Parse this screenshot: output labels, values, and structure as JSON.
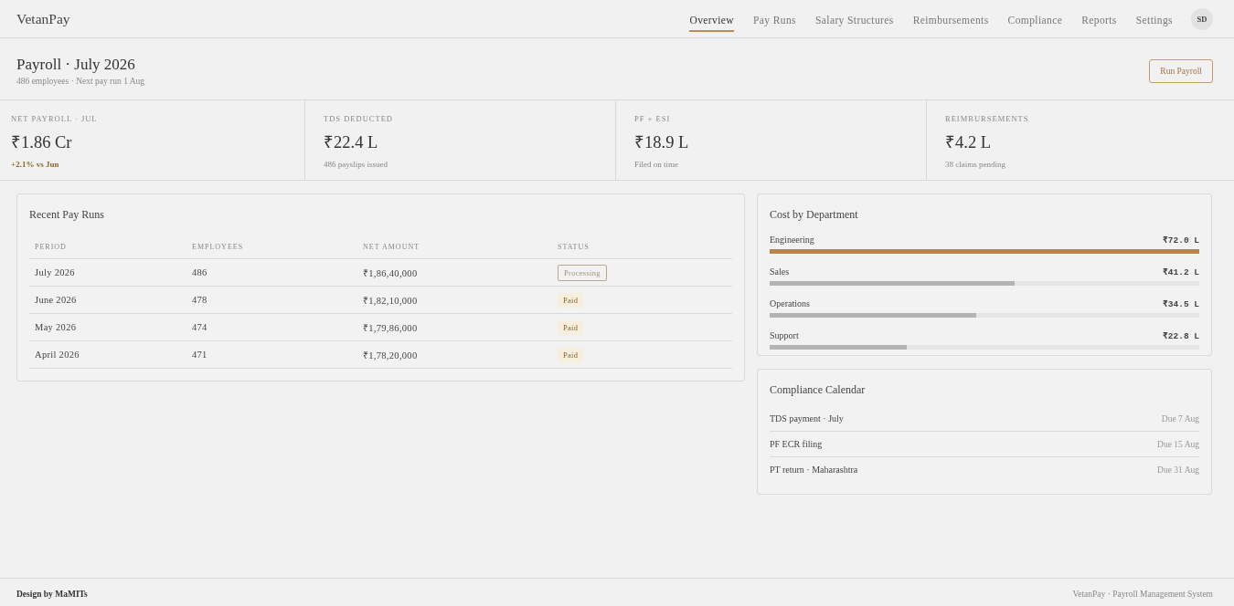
{
  "app": {
    "logo": "VetanPay"
  },
  "nav": [
    {
      "label": "Overview",
      "selected": true
    },
    {
      "label": "Pay Runs",
      "selected": false
    },
    {
      "label": "Salary Structures",
      "selected": false
    },
    {
      "label": "Reimbursements",
      "selected": false
    },
    {
      "label": "Compliance",
      "selected": false
    },
    {
      "label": "Reports",
      "selected": false
    },
    {
      "label": "Settings",
      "selected": false
    }
  ],
  "user": {
    "initials": "SD"
  },
  "page_header": {
    "title": "Payroll · July 2026",
    "subtitle": "486 employees · Next pay run 1 Aug",
    "action": "Run Payroll"
  },
  "stats": [
    {
      "label": "NET PAYROLL · JUL",
      "value": "₹1.86 Cr",
      "note": "+2.1% vs Jun",
      "positive": true
    },
    {
      "label": "TDS DEDUCTED",
      "value": "₹22.4 L",
      "note": "486 payslips issued",
      "positive": false
    },
    {
      "label": "PF + ESI",
      "value": "₹18.9 L",
      "note": "Filed on time",
      "positive": false
    },
    {
      "label": "REIMBURSEMENTS",
      "value": "₹4.2 L",
      "note": "38 claims pending",
      "positive": false
    }
  ],
  "pay_runs": {
    "title": "Recent Pay Runs",
    "columns": [
      "PERIOD",
      "EMPLOYEES",
      "NET AMOUNT",
      "STATUS"
    ],
    "rows": [
      {
        "period": "July 2026",
        "employees": "486",
        "net_amount": "₹1,86,40,000",
        "status": {
          "label": "Processing",
          "kind": "processing"
        }
      },
      {
        "period": "June 2026",
        "employees": "478",
        "net_amount": "₹1,82,10,000",
        "status": {
          "label": "Paid",
          "kind": "paid"
        }
      },
      {
        "period": "May 2026",
        "employees": "474",
        "net_amount": "₹1,79,86,000",
        "status": {
          "label": "Paid",
          "kind": "paid"
        }
      },
      {
        "period": "April 2026",
        "employees": "471",
        "net_amount": "₹1,78,20,000",
        "status": {
          "label": "Paid",
          "kind": "paid"
        }
      }
    ]
  },
  "department_cost": {
    "title": "Cost by Department",
    "items": [
      {
        "name": "Engineering",
        "amount": "₹72.0 L",
        "level": 1,
        "highlighted": true
      },
      {
        "name": "Sales",
        "amount": "₹41.2 L",
        "level": 0.57,
        "highlighted": false
      },
      {
        "name": "Operations",
        "amount": "₹34.5 L",
        "level": 0.48,
        "highlighted": false
      },
      {
        "name": "Support",
        "amount": "₹22.8 L",
        "level": 0.32,
        "highlighted": false
      }
    ]
  },
  "compliance": {
    "title": "Compliance Calendar",
    "items": [
      {
        "task": "TDS payment · July",
        "due": "Due 7 Aug"
      },
      {
        "task": "PF ECR filing",
        "due": "Due 15 Aug"
      },
      {
        "task": "PT return · Maharashtra",
        "due": "Due 31 Aug"
      }
    ]
  },
  "footer": {
    "credit": "Design by MaMITs",
    "product": "VetanPay · Payroll Management System"
  }
}
